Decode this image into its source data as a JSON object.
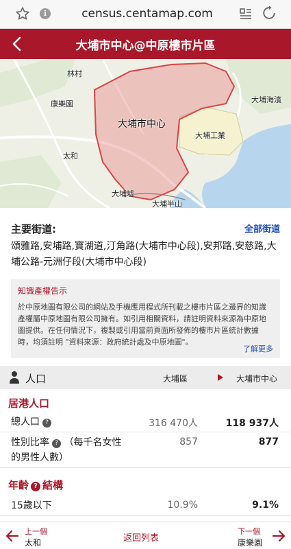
{
  "browser": {
    "url": "census.centamap.com",
    "icons": [
      "star-icon",
      "info-icon",
      "reader-mode-icon",
      "reload-icon"
    ]
  },
  "header": {
    "title": "大埔市中心@中原樓市片區",
    "back_icon": "chevron-left-icon",
    "color": "#a9182a"
  },
  "map": {
    "labels": {
      "lam_tsuen": "林村",
      "hong_lok_yuen": "康樂園",
      "tai_wo": "太和",
      "centre": "大埔市中心",
      "industrial": "大埔工業",
      "tai_po_hoi": "大埔海濱",
      "tai_po_kau": "大埔墟",
      "tai_po_bun_shan": "大埔半山"
    }
  },
  "streets": {
    "title": "主要街道:",
    "all_link": "全部街道",
    "list": "頌雅路,安埔路,寶湖道,汀角路(大埔市中心段),安邦路,安慈路,大埔公路-元洲仔段(大埔市中心段)"
  },
  "notice": {
    "title": "知識產權告示",
    "body": "於中原地圖有限公司的網站及手機應用程式所刊載之樓市片區之邊界的知識產權屬中原地圖有限公司擁有。如引用相關資料，請註明資料來源為中原地圖提供。在任何情況下，複製或引用當前頁面所發佈的樓市片區統計數據時，均須註明 \"資料來源：政府統計處及中原地圖\"。",
    "more": "了解更多"
  },
  "table": {
    "title": "人口",
    "col1": "大埔區",
    "col2": "大埔市中心",
    "section_resident": "居港人口",
    "rows": [
      {
        "label": "總人口",
        "v1": "316 470人",
        "v2": "118 937人"
      },
      {
        "label": "性別比率",
        "note": "（每千名女性的男性人數）",
        "v1": "857",
        "v2": "877"
      }
    ],
    "section_age_a": "年齡",
    "section_age_b": "結構",
    "age_rows": [
      {
        "label": "15歲以下",
        "v1": "10.9%",
        "v2": "9.1%"
      }
    ]
  },
  "bottom_nav": {
    "prev_kicker": "上一個",
    "prev_name": "太和",
    "back_to_list": "返回列表",
    "next_kicker": "下一個",
    "next_name": "康樂園"
  }
}
